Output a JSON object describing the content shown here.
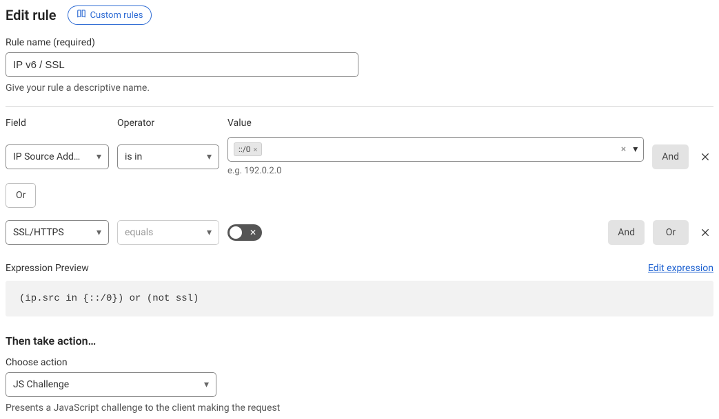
{
  "header": {
    "title": "Edit rule",
    "custom_rules": "Custom rules"
  },
  "rule_name": {
    "label": "Rule name (required)",
    "value": "IP v6 / SSL",
    "hint": "Give your rule a descriptive name."
  },
  "columns": {
    "field": "Field",
    "operator": "Operator",
    "value": "Value"
  },
  "rows": [
    {
      "field": "IP Source Add…",
      "operator": "is in",
      "operator_disabled": false,
      "value_type": "tags",
      "tags": [
        "::/0"
      ],
      "example": "e.g. 192.0.2.0",
      "actions": [
        "And"
      ]
    },
    {
      "field": "SSL/HTTPS",
      "operator": "equals",
      "operator_disabled": true,
      "value_type": "toggle",
      "toggle_on": false,
      "actions": [
        "And",
        "Or"
      ]
    }
  ],
  "or_separator": "Or",
  "preview": {
    "label": "Expression Preview",
    "edit": "Edit expression",
    "code": "(ip.src in {::/0}) or (not ssl)"
  },
  "action": {
    "heading": "Then take action…",
    "label": "Choose action",
    "value": "JS Challenge",
    "hint": "Presents a JavaScript challenge to the client making the request"
  }
}
